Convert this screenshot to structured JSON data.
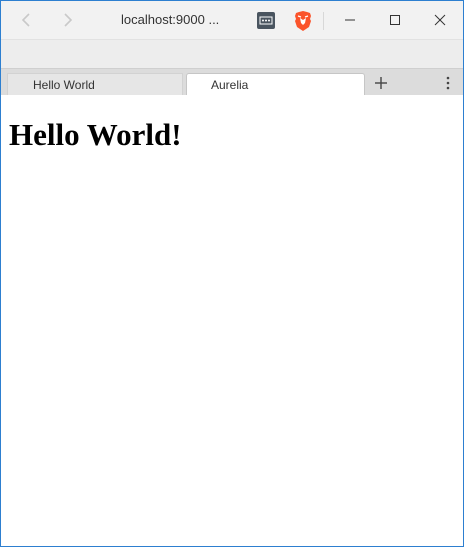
{
  "titlebar": {
    "url": "localhost:9000 ...",
    "back_icon": "chevron-left-icon",
    "forward_icon": "chevron-right-icon",
    "extension_icon": "more-dots-icon",
    "brave_icon": "brave-lion-icon",
    "brave_color": "#fb542b",
    "window_controls": [
      "minimize-icon",
      "maximize-icon",
      "close-icon"
    ]
  },
  "tabs": [
    {
      "label": "Hello World",
      "active": false
    },
    {
      "label": "Aurelia",
      "active": true
    }
  ],
  "tab_actions": {
    "new_tab_icon": "plus-icon",
    "menu_icon": "vertical-dots-icon"
  },
  "page": {
    "heading": "Hello World!"
  },
  "colors": {
    "window_border": "#2d7fd0",
    "titlebar_bg": "#f2f2f2",
    "tabstrip_bg": "#dcdcdc"
  }
}
